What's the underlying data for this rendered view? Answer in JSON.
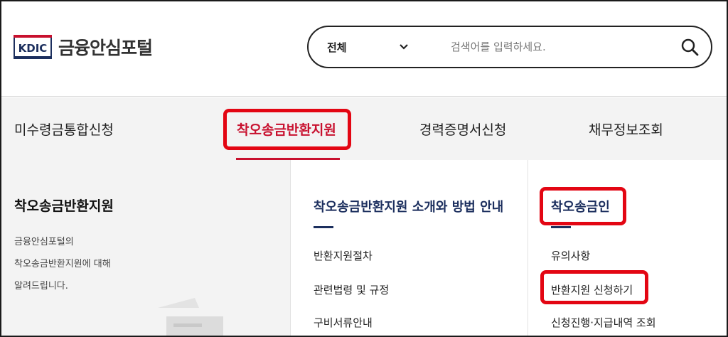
{
  "header": {
    "logo_mark": "KDIC",
    "logo_text": "금융안심포털",
    "search": {
      "select_value": "전체",
      "placeholder": "검색어를 입력하세요."
    }
  },
  "nav": {
    "items": [
      {
        "label": "미수령금통합신청"
      },
      {
        "label": "착오송금반환지원"
      },
      {
        "label": "경력증명서신청"
      },
      {
        "label": "채무정보조회"
      }
    ]
  },
  "panel": {
    "left": {
      "title": "착오송금반환지원",
      "desc_lines": [
        "금융안심포털의",
        "착오송금반환지원에 대해",
        "알려드립니다."
      ]
    },
    "col1": {
      "title": "착오송금반환지원 소개와 방법 안내",
      "links": [
        "반환지원절차",
        "관련법령 및 규정",
        "구비서류안내"
      ]
    },
    "col2": {
      "title": "착오송금인",
      "links": [
        "유의사항",
        "반환지원 신청하기",
        "신청진행·지급내역 조회"
      ]
    }
  },
  "colors": {
    "accent_red": "#c8102e",
    "highlight_red": "#e30613",
    "navy": "#1c2f5e",
    "nav_bg": "#f3f3f3"
  }
}
